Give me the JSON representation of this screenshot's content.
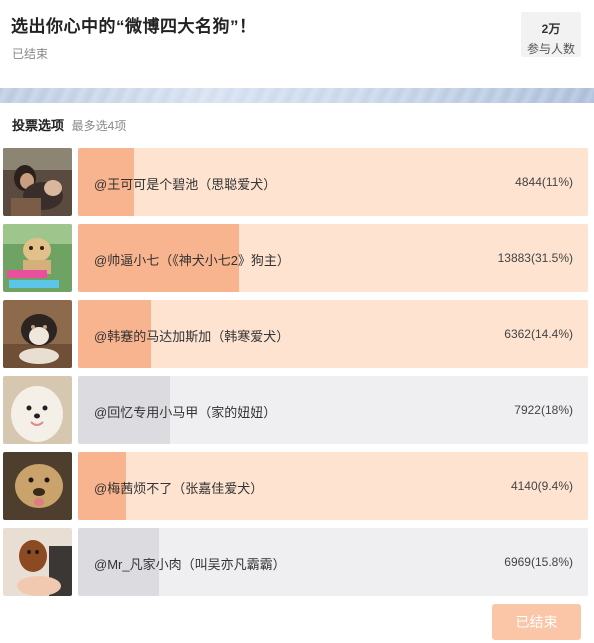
{
  "poll": {
    "title": "选出你心中的“微博四大名狗”！",
    "status": "已结束",
    "participants_count": "2万",
    "participants_label": "参与人数"
  },
  "section": {
    "title": "投票选项",
    "hint": "最多选4项"
  },
  "options": [
    {
      "label": "@王可可是个碧池（思聪爱犬）",
      "votes": "4844(11%)",
      "percent": 11,
      "highlight": true
    },
    {
      "label": "@帅逼小七（《神犬小七2》狗主）",
      "votes": "13883(31.5%)",
      "percent": 31.5,
      "highlight": true
    },
    {
      "label": "@韩蹇的马达加斯加（韩寒爱犬）",
      "votes": "6362(14.4%)",
      "percent": 14.4,
      "highlight": true
    },
    {
      "label": "@回忆专用小马甲（家的妞妞）",
      "votes": "7922(18%)",
      "percent": 18,
      "highlight": false
    },
    {
      "label": "@梅茜烦不了（张嘉佳爱犬）",
      "votes": "4140(9.4%)",
      "percent": 9.4,
      "highlight": true
    },
    {
      "label": "@Mr_凡家小肉（叫吴亦凡霸霸）",
      "votes": "6969(15.8%)",
      "percent": 15.8,
      "highlight": false
    }
  ],
  "footer": {
    "button_label": "已结束"
  },
  "colors": {
    "selected_bar_bg": "#fde3d0",
    "selected_bar_fill": "#f8b48e",
    "unselected_bar_bg": "#efeff1",
    "unselected_bar_fill": "#dcdce0",
    "button_bg": "#fbc5a8"
  }
}
